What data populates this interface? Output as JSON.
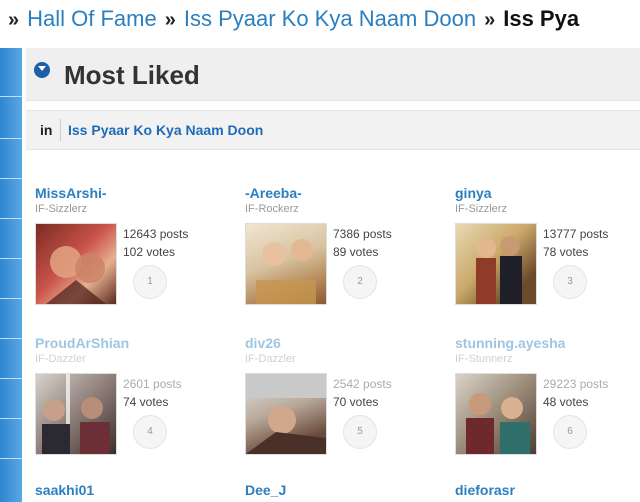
{
  "breadcrumb": [
    {
      "label": "Hall Of Fame"
    },
    {
      "label": "Iss Pyaar Ko Kya Naam Doon"
    },
    {
      "label": "Iss Pya"
    }
  ],
  "header": {
    "title": "Most Liked"
  },
  "filter": {
    "in_label": "in",
    "link_label": "Iss Pyaar Ko Kya Naam Doon"
  },
  "members": [
    {
      "name": "MissArshi-",
      "rank": "IF-Sizzlerz",
      "posts": "12643 posts",
      "votes": "102 votes",
      "position": "1"
    },
    {
      "name": "-Areeba-",
      "rank": "IF-Rockerz",
      "posts": "7386 posts",
      "votes": "89 votes",
      "position": "2"
    },
    {
      "name": "ginya",
      "rank": "IF-Sizzlerz",
      "posts": "13777 posts",
      "votes": "78 votes",
      "position": "3"
    },
    {
      "name": "ProudArShian",
      "rank": "IF-Dazzler",
      "posts": "2601 posts",
      "votes": "74 votes",
      "position": "4"
    },
    {
      "name": "div26",
      "rank": "IF-Dazzler",
      "posts": "2542 posts",
      "votes": "70 votes",
      "position": "5"
    },
    {
      "name": "stunning.ayesha",
      "rank": "IF-Stunnerz",
      "posts": "29223 posts",
      "votes": "48 votes",
      "position": "6"
    }
  ],
  "bottom_row": [
    {
      "name": "saakhi01"
    },
    {
      "name": "Dee_J"
    },
    {
      "name": "dieforasr"
    }
  ]
}
